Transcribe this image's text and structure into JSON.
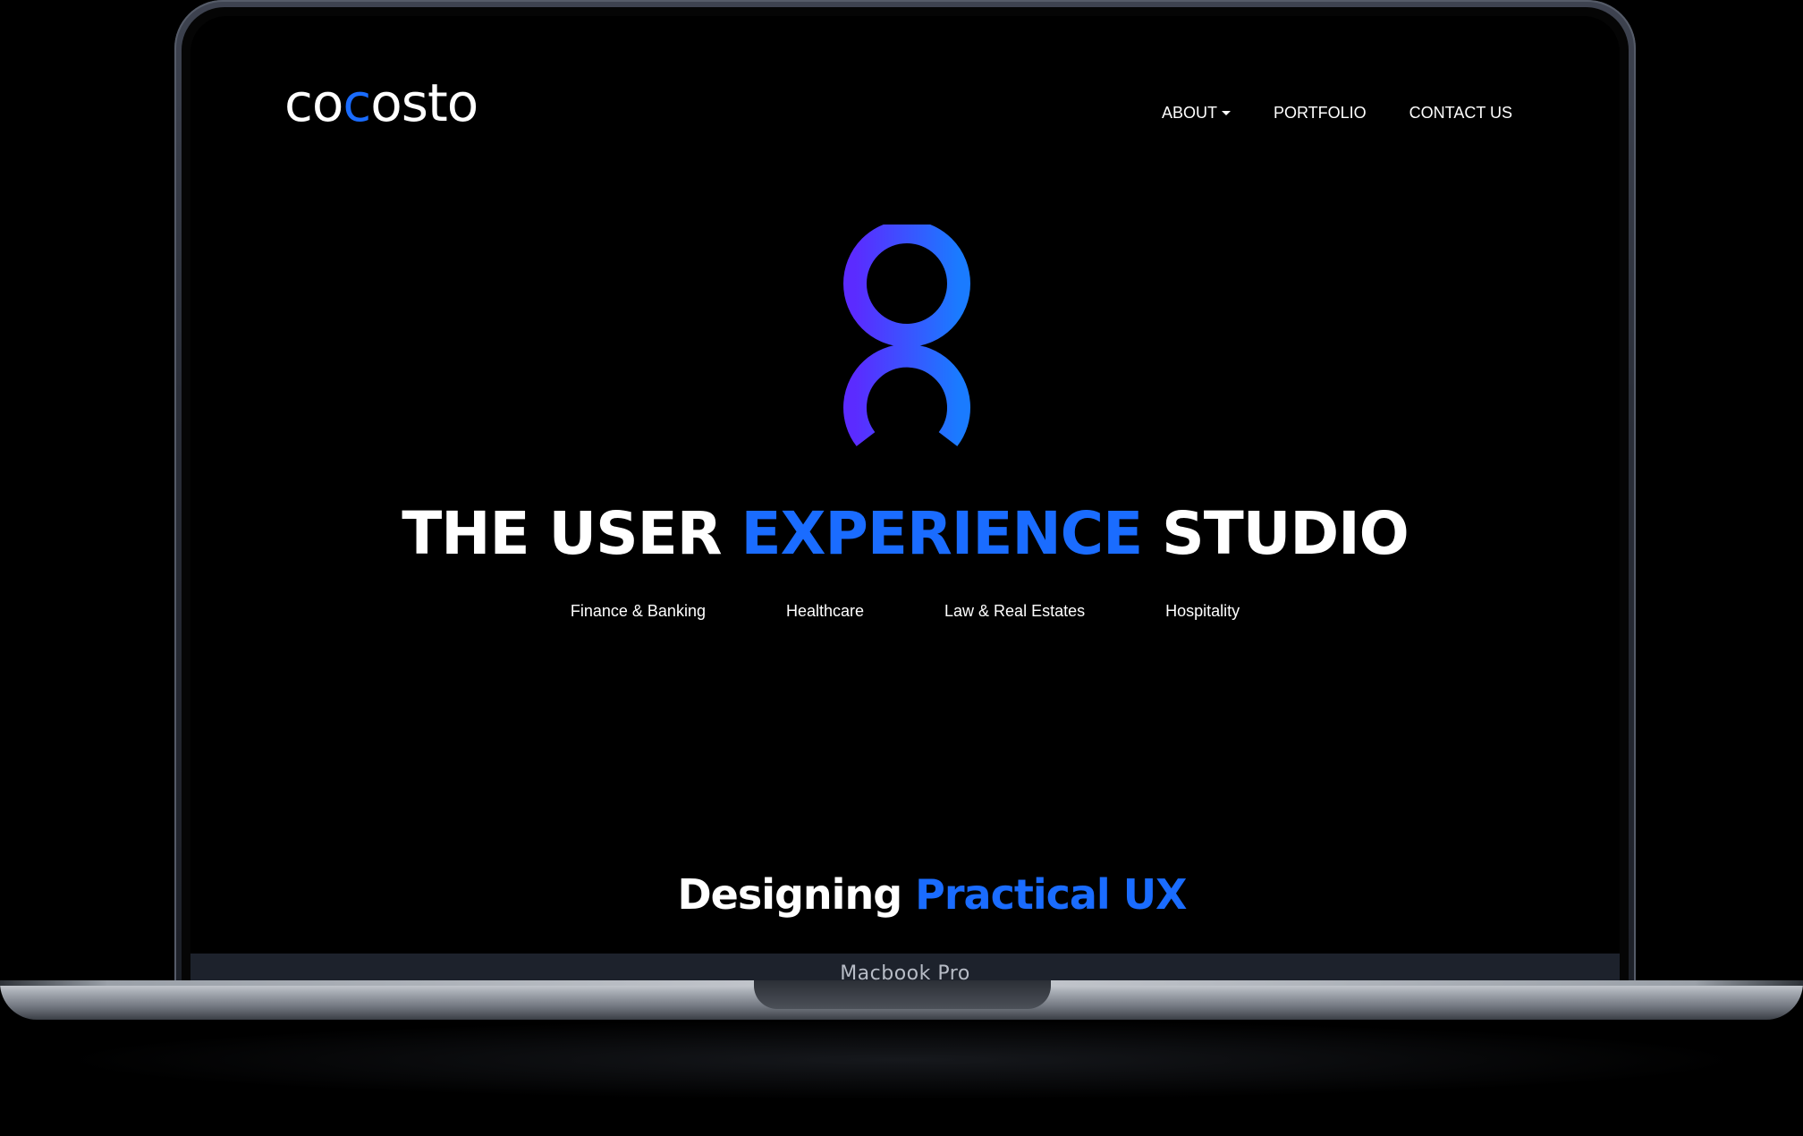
{
  "device": {
    "label": "Macbook Pro"
  },
  "site": {
    "logo": {
      "part1": "co",
      "part2": "c",
      "part3": "osto"
    },
    "nav": {
      "about": "ABOUT",
      "portfolio": "PORTFOLIO",
      "contact": "CONTACT US"
    },
    "hero": {
      "title_part1": "THE USER ",
      "title_highlight": "EXPERIENCE",
      "title_part2": " STUDIO",
      "sectors": [
        "Finance & Banking",
        "Healthcare",
        "Law & Real Estates",
        "Hospitality"
      ]
    },
    "section": {
      "title_part1": "Designing ",
      "title_highlight": "Practical UX"
    }
  },
  "colors": {
    "accent": "#1a6cff",
    "background": "#000000",
    "gradient_start": "#5b2bff",
    "gradient_end": "#1a7bff"
  }
}
